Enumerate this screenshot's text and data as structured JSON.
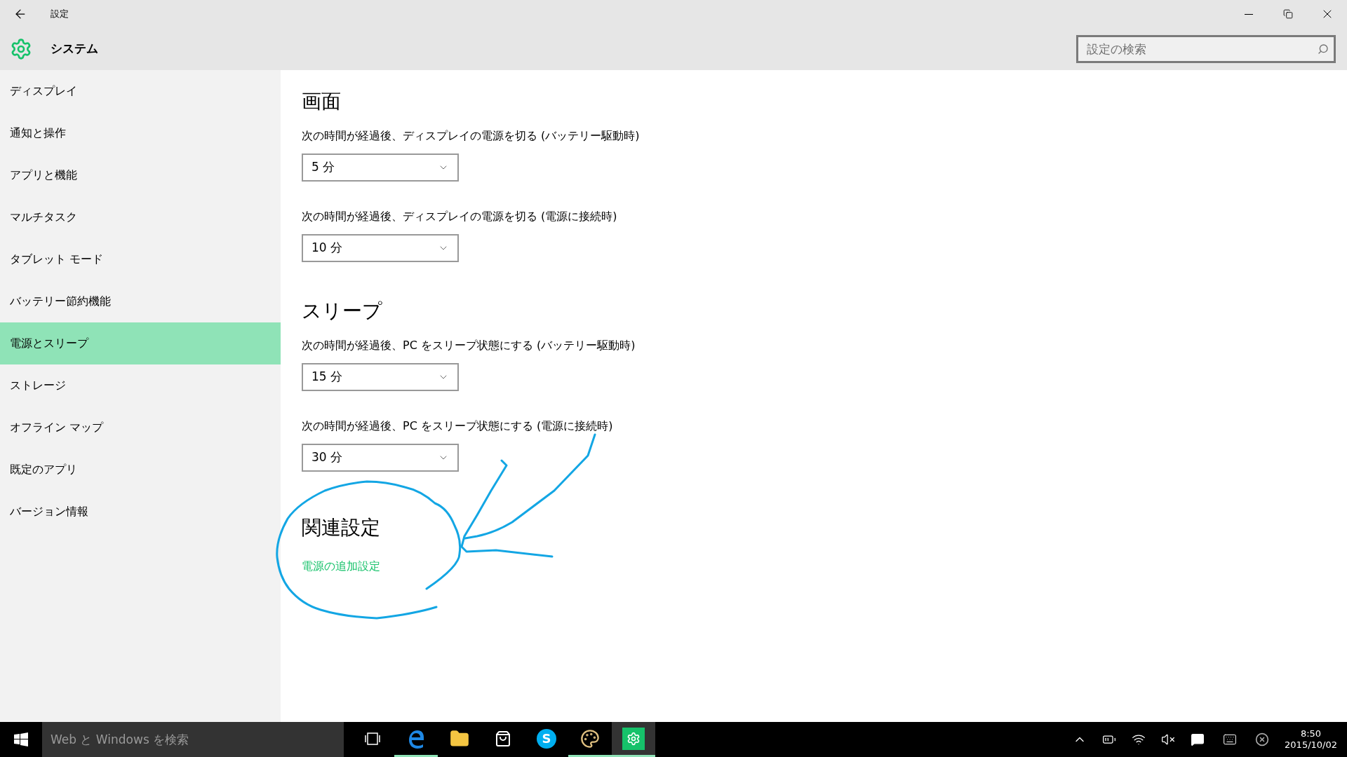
{
  "window": {
    "title": "設定",
    "page": "システム"
  },
  "search": {
    "placeholder": "設定の検索"
  },
  "sidebar": {
    "items": [
      {
        "label": "ディスプレイ",
        "selected": false
      },
      {
        "label": "通知と操作",
        "selected": false
      },
      {
        "label": "アプリと機能",
        "selected": false
      },
      {
        "label": "マルチタスク",
        "selected": false
      },
      {
        "label": "タブレット モード",
        "selected": false
      },
      {
        "label": "バッテリー節約機能",
        "selected": false
      },
      {
        "label": "電源とスリープ",
        "selected": true
      },
      {
        "label": "ストレージ",
        "selected": false
      },
      {
        "label": "オフライン マップ",
        "selected": false
      },
      {
        "label": "既定のアプリ",
        "selected": false
      },
      {
        "label": "バージョン情報",
        "selected": false
      }
    ]
  },
  "sections": [
    {
      "heading": "画面",
      "settings": [
        {
          "label": "次の時間が経過後、ディスプレイの電源を切る (バッテリー駆動時)",
          "value": "5 分"
        },
        {
          "label": "次の時間が経過後、ディスプレイの電源を切る (電源に接続時)",
          "value": "10 分"
        }
      ]
    },
    {
      "heading": "スリープ",
      "settings": [
        {
          "label": "次の時間が経過後、PC をスリープ状態にする (バッテリー駆動時)",
          "value": "15 分"
        },
        {
          "label": "次の時間が経過後、PC をスリープ状態にする (電源に接続時)",
          "value": "30 分"
        }
      ]
    }
  ],
  "related": {
    "heading": "関連設定",
    "link": "電源の追加設定"
  },
  "taskbar": {
    "search_placeholder": "Web と Windows を検索",
    "apps": [
      {
        "kind": "taskview",
        "running": false,
        "active": false
      },
      {
        "kind": "edge",
        "running": true,
        "active": false
      },
      {
        "kind": "explorer",
        "running": false,
        "active": false
      },
      {
        "kind": "store",
        "running": false,
        "active": false
      },
      {
        "kind": "skype",
        "logo": "S",
        "running": false,
        "active": false
      },
      {
        "kind": "paint",
        "running": true,
        "active": false
      },
      {
        "kind": "settings",
        "running": true,
        "active": true
      }
    ],
    "time": "8:50",
    "date": "2015/10/02"
  }
}
